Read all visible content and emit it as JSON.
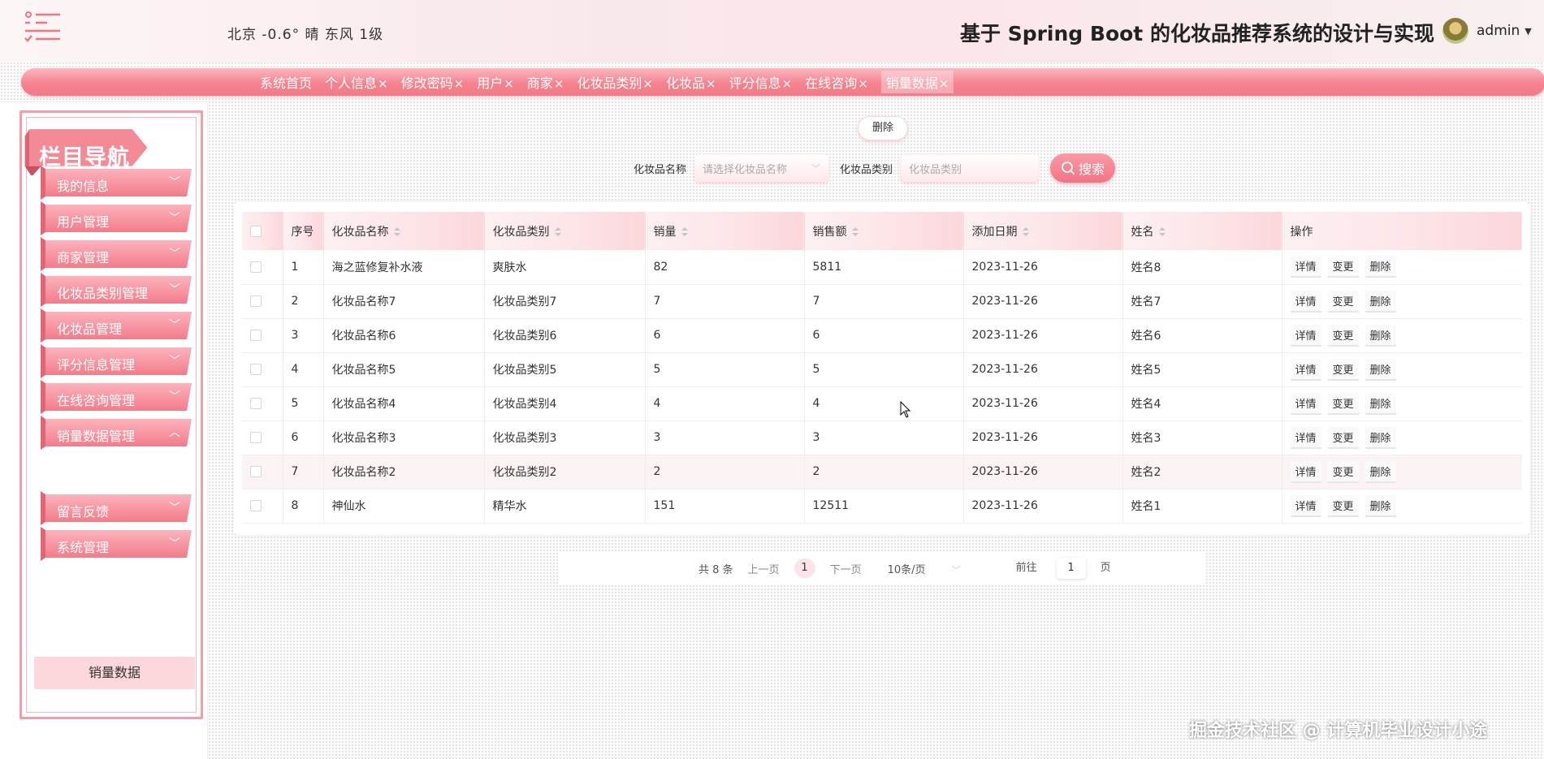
{
  "header": {
    "weather": "北京  -0.6°  晴  东风  1级",
    "title": "基于 Spring Boot 的化妆品推荐系统的设计与实现",
    "user": "admin"
  },
  "tabs": [
    {
      "label": "系统首页",
      "close": ""
    },
    {
      "label": "个人信息",
      "close": "×"
    },
    {
      "label": "修改密码",
      "close": "×"
    },
    {
      "label": "用户",
      "close": "×"
    },
    {
      "label": "商家",
      "close": "×"
    },
    {
      "label": "化妆品类别",
      "close": "×"
    },
    {
      "label": "化妆品",
      "close": "×"
    },
    {
      "label": "评分信息",
      "close": "×"
    },
    {
      "label": "在线咨询",
      "close": "×"
    },
    {
      "label": "销量数据",
      "close": "×"
    }
  ],
  "sidebar": {
    "banner": "栏目导航",
    "items": [
      {
        "label": "我的信息",
        "chev": "﹀"
      },
      {
        "label": "用户管理",
        "chev": "﹀"
      },
      {
        "label": "商家管理",
        "chev": "﹀"
      },
      {
        "label": "化妆品类别管理",
        "chev": "﹀"
      },
      {
        "label": "化妆品管理",
        "chev": "﹀"
      },
      {
        "label": "评分信息管理",
        "chev": "﹀"
      },
      {
        "label": "在线咨询管理",
        "chev": "﹀"
      },
      {
        "label": "销量数据管理",
        "chev": "︿"
      },
      {
        "label": "留言反馈",
        "chev": "﹀"
      },
      {
        "label": "系统管理",
        "chev": "﹀"
      }
    ],
    "sub_item": "销量数据"
  },
  "toolbar": {
    "delete_label": "删除"
  },
  "search": {
    "name_label": "化妆品名称",
    "name_placeholder": "请选择化妆品名称",
    "type_label": "化妆品类别",
    "type_placeholder": "化妆品类别",
    "search_label": "搜索"
  },
  "table": {
    "headers": [
      "序号",
      "化妆品名称",
      "化妆品类别",
      "销量",
      "销售额",
      "添加日期",
      "姓名",
      "操作"
    ],
    "actions": [
      "详情",
      "变更",
      "删除"
    ],
    "rows": [
      [
        "1",
        "海之蓝修复补水液",
        "爽肤水",
        "82",
        "5811",
        "2023-11-26",
        "姓名8"
      ],
      [
        "2",
        "化妆品名称7",
        "化妆品类别7",
        "7",
        "7",
        "2023-11-26",
        "姓名7"
      ],
      [
        "3",
        "化妆品名称6",
        "化妆品类别6",
        "6",
        "6",
        "2023-11-26",
        "姓名6"
      ],
      [
        "4",
        "化妆品名称5",
        "化妆品类别5",
        "5",
        "5",
        "2023-11-26",
        "姓名5"
      ],
      [
        "5",
        "化妆品名称4",
        "化妆品类别4",
        "4",
        "4",
        "2023-11-26",
        "姓名4"
      ],
      [
        "6",
        "化妆品名称3",
        "化妆品类别3",
        "3",
        "3",
        "2023-11-26",
        "姓名3"
      ],
      [
        "7",
        "化妆品名称2",
        "化妆品类别2",
        "2",
        "2",
        "2023-11-26",
        "姓名2"
      ],
      [
        "8",
        "神仙水",
        "精华水",
        "151",
        "12511",
        "2023-11-26",
        "姓名1"
      ]
    ]
  },
  "pager": {
    "total": "共 8 条",
    "prev": "上一页",
    "current": "1",
    "next": "下一页",
    "size": "10条/页",
    "goto_prefix": "前往",
    "goto_value": "1",
    "goto_suffix": "页"
  },
  "watermark": "掘金技术社区 @ 计算机毕业设计小途",
  "colors": {
    "accent": "#f37484",
    "accent_light": "#fcd7dc"
  }
}
